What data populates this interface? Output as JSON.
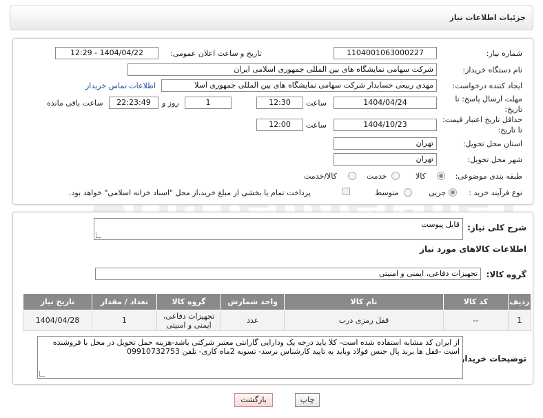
{
  "header": {
    "title": "جزئیات اطلاعات نیاز"
  },
  "form": {
    "need_number_label": "شماره نیاز:",
    "need_number": "1104001063000227",
    "announce_label": "تاریخ و ساعت اعلان عمومی:",
    "announce_value": "1404/04/22 - 12:29",
    "buyer_org_label": "نام دستگاه خریدار:",
    "buyer_org": "شرکت سهامی نمایشگاه های بین المللی جمهوری اسلامی ایران",
    "requester_label": "ایجاد کننده درخواست:",
    "requester": "مهدی  ربیعی حسابدار شرکت سهامی نمایشگاه های بین المللی جمهوری اسلا",
    "contact_link": "اطلاعات تماس خریدار",
    "deadline_label": "مهلت ارسال پاسخ: تا تاریخ:",
    "deadline_date": "1404/04/24",
    "time_label": "ساعت",
    "deadline_time": "12:30",
    "days_value": "1",
    "days_label": "روز و",
    "remaining_time": "22:23:49",
    "remaining_label": "ساعت باقی مانده",
    "price_validity_label": "حداقل تاریخ اعتبار قیمت: تا تاریخ:",
    "price_validity_date": "1404/10/23",
    "price_validity_time": "12:00",
    "province_label": "استان محل تحویل:",
    "province": "تهران",
    "city_label": "شهر محل تحویل:",
    "city": "تهران",
    "category_label": "طبقه بندی موضوعی:",
    "category_options": [
      "کالا",
      "خدمت",
      "کالا/خدمت"
    ],
    "process_label": "نوع فرآیند خرید :",
    "process_options": [
      "جزیی",
      "متوسط"
    ],
    "payment_note": "پرداخت تمام یا بخشی از مبلغ خرید،از محل \"اسناد خزانه اسلامی\" خواهد بود."
  },
  "description": {
    "summary_label": "شرح کلی نیاز:",
    "summary_value": "قابل پیوست",
    "items_title": "اطلاعات کالاهای مورد نیاز",
    "group_label": "گروه کالا:",
    "group_value": "تجهیزات دفاعی، ایمنی و امنیتی"
  },
  "table": {
    "headers": [
      "ردیف",
      "کد کالا",
      "نام کالا",
      "واحد شمارش",
      "گروه کالا",
      "تعداد / مقدار",
      "تاریخ نیاز"
    ],
    "rows": [
      [
        "1",
        "--",
        "قفل رمزی درب",
        "عدد",
        "تجهیزات دفاعی، ایمنی و امنیتی",
        "1",
        "1404/04/28"
      ]
    ]
  },
  "buyer_notes": {
    "label": "توضیحات خریدار:",
    "text": "از ایران کد مشابه استفاده شده است- کلا باید درجه یک  ودارایی گارانتی معتبر شرکتی باشد-هزینه حمل تحویل در محل با فروشنده است -قفل ها برند پال جنس فولاد وباید به تایید کارشناس برسد- تسویه 2ماه کاری- تلفن 09910732753"
  },
  "buttons": {
    "print": "چاپ",
    "back": "بازگشت"
  },
  "watermark": "AriaTender.neT"
}
